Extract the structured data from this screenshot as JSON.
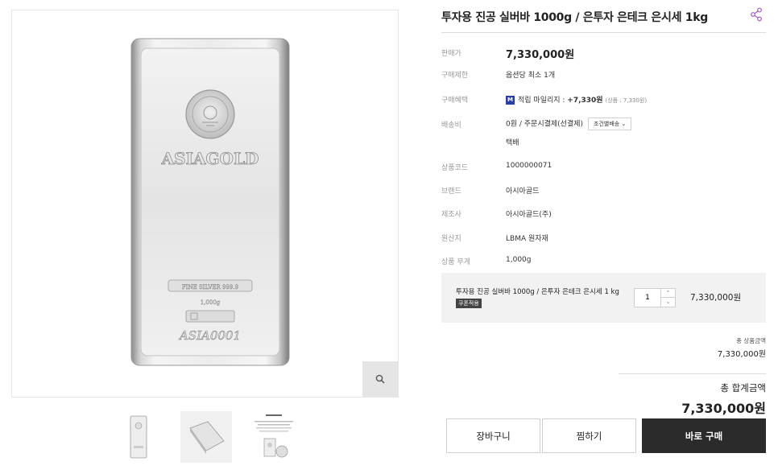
{
  "product": {
    "title": "투자용 진공 실버바 1000g / 은투자 은테크 은시세 1kg",
    "bar_brand_text": "ASIAGOLD",
    "bar_fine_text": "FINE SILVER 999.9",
    "bar_weight_text": "1,000g",
    "bar_bottom_text": "ASIA0001"
  },
  "details": {
    "price_label": "판매가",
    "price_value": "7,330,000원",
    "limit_label": "구매제한",
    "limit_value": "옵션당 최소 1개",
    "benefit_label": "구매혜택",
    "benefit_badge": "M",
    "benefit_text_prefix": "적립 마일리지 : ",
    "benefit_amount": "+7,330원",
    "benefit_note": "(상품 : 7,330원)",
    "shipping_label": "배송비",
    "shipping_value": "0원  / 주문시결제(선결제)",
    "shipping_button": "조건별배송 ⌄",
    "shipping_method": "택배",
    "code_label": "상품코드",
    "code_value": "1000000071",
    "brand_label": "브랜드",
    "brand_value": "아시아골드",
    "maker_label": "제조사",
    "maker_value": "아시아골드(주)",
    "origin_label": "원산지",
    "origin_value": "LBMA 원자재",
    "weight_label": "상품 무게",
    "weight_value": "1,000g"
  },
  "option": {
    "name": "투자용 진공 실버바 1000g / 은투자 은테크 은시세 1 kg",
    "coupon": "쿠폰적용",
    "quantity": "1",
    "price": "7,330,000원"
  },
  "totals": {
    "product_total_label": "총 상품금액",
    "product_total_value": "7,330,000원",
    "grand_total_label": "총 합계금액",
    "grand_total_value": "7,330,000원"
  },
  "buttons": {
    "cart": "장바구니",
    "wish": "찜하기",
    "buy": "바로 구매"
  },
  "icons": {
    "zoom": "search-icon",
    "share": "share-icon",
    "qty_up": "chevron-up-icon",
    "qty_down": "chevron-down-icon"
  },
  "colors": {
    "mileage_badge": "#2a3fa0",
    "buy_button": "#2b2b2b",
    "option_box": "#f2f2f2",
    "share_icon": "#9b59b6"
  }
}
